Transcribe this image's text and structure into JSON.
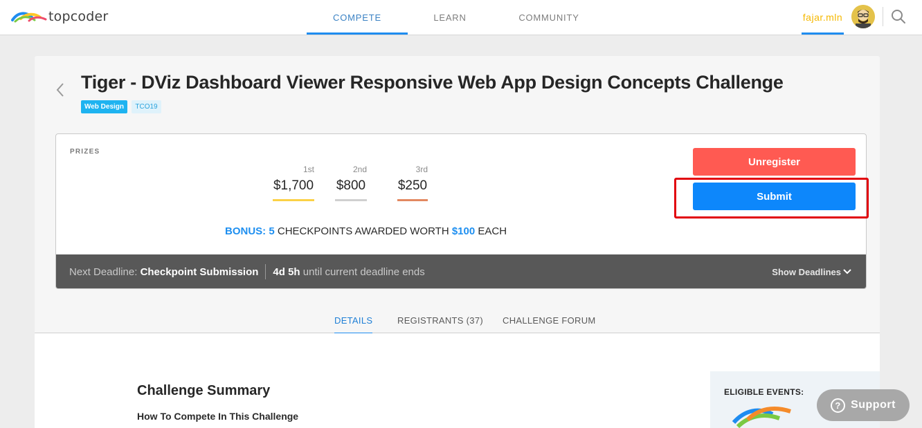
{
  "header": {
    "logo_text": "topcoder",
    "nav": [
      "COMPETE",
      "LEARN",
      "COMMUNITY"
    ],
    "active_nav": "COMPETE",
    "username": "fajar.mln"
  },
  "challenge": {
    "title": "Tiger - DViz Dashboard Viewer Responsive Web App Design Concepts Challenge",
    "tags": [
      "Web Design",
      "TCO19"
    ],
    "prizes_label": "PRIZES",
    "prizes": [
      {
        "place": "1st",
        "amount": "$1,700"
      },
      {
        "place": "2nd",
        "amount": "$800"
      },
      {
        "place": "3rd",
        "amount": "$250"
      }
    ],
    "bonus": {
      "label": "BONUS:",
      "count": "5",
      "text": "CHECKPOINTS AWARDED WORTH",
      "amount": "$100",
      "suffix": "EACH"
    },
    "buttons": {
      "unregister": "Unregister",
      "submit": "Submit"
    },
    "deadline": {
      "prefix": "Next Deadline:",
      "name": "Checkpoint Submission",
      "time": "4d 5h",
      "suffix": "until current deadline ends",
      "toggle": "Show Deadlines"
    },
    "tabs": [
      "DETAILS",
      "REGISTRANTS (37)",
      "CHALLENGE FORUM"
    ],
    "active_tab": "DETAILS"
  },
  "details": {
    "summary_title": "Challenge Summary",
    "howto": "How To Compete In This Challenge",
    "eligible_events_label": "ELIGIBLE EVENTS:"
  },
  "support": {
    "label": "Support"
  },
  "colors": {
    "accent_blue": "#0d87fb",
    "unregister_red": "#ff5a52",
    "highlight_red": "#e1000b",
    "username_gold": "#f5b800"
  }
}
